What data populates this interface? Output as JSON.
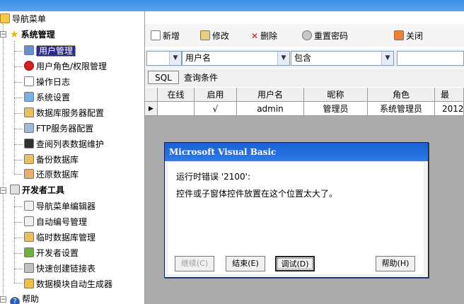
{
  "tree": {
    "root": "导航菜单",
    "system_group": "系统管理",
    "system_items": [
      "用户管理",
      "用户角色/权限管理",
      "操作日志",
      "系统设置",
      "数据库服务器配置",
      "FTP服务器配置",
      "查阅列表数据维护",
      "备份数据库",
      "还原数据库"
    ],
    "dev_group": "开发者工具",
    "dev_items": [
      "导航菜单编辑器",
      "自动编号管理",
      "临时数据库管理",
      "开发者设置",
      "快速创建链接表",
      "数据模块自动生成器"
    ],
    "help": "帮助"
  },
  "toolbar": {
    "new": "新增",
    "edit": "修改",
    "delete": "删除",
    "reset_password": "重置密码",
    "close": "关闭"
  },
  "filter": {
    "field": "用户名",
    "operator": "包含",
    "value": ""
  },
  "sql": {
    "button": "SQL",
    "label": "查询条件"
  },
  "grid": {
    "headers": [
      "在线",
      "启用",
      "用户名",
      "昵称",
      "角色",
      "最"
    ],
    "row": [
      "",
      "√",
      "admin",
      "管理员",
      "系统管理员",
      "2012"
    ]
  },
  "dialog": {
    "title": "Microsoft Visual Basic",
    "line1": "运行时错误 '2100':",
    "line2": "控件或子窗体控件放置在这个位置太大了。",
    "btn_continue": "继续(C)",
    "btn_end": "结束(E)",
    "btn_debug": "调试(D)",
    "btn_help": "帮助(H)"
  },
  "colors": {
    "selection": "#2b2b86",
    "dialog_title": "#1a5fd4",
    "grid_bg": "#ababab"
  }
}
